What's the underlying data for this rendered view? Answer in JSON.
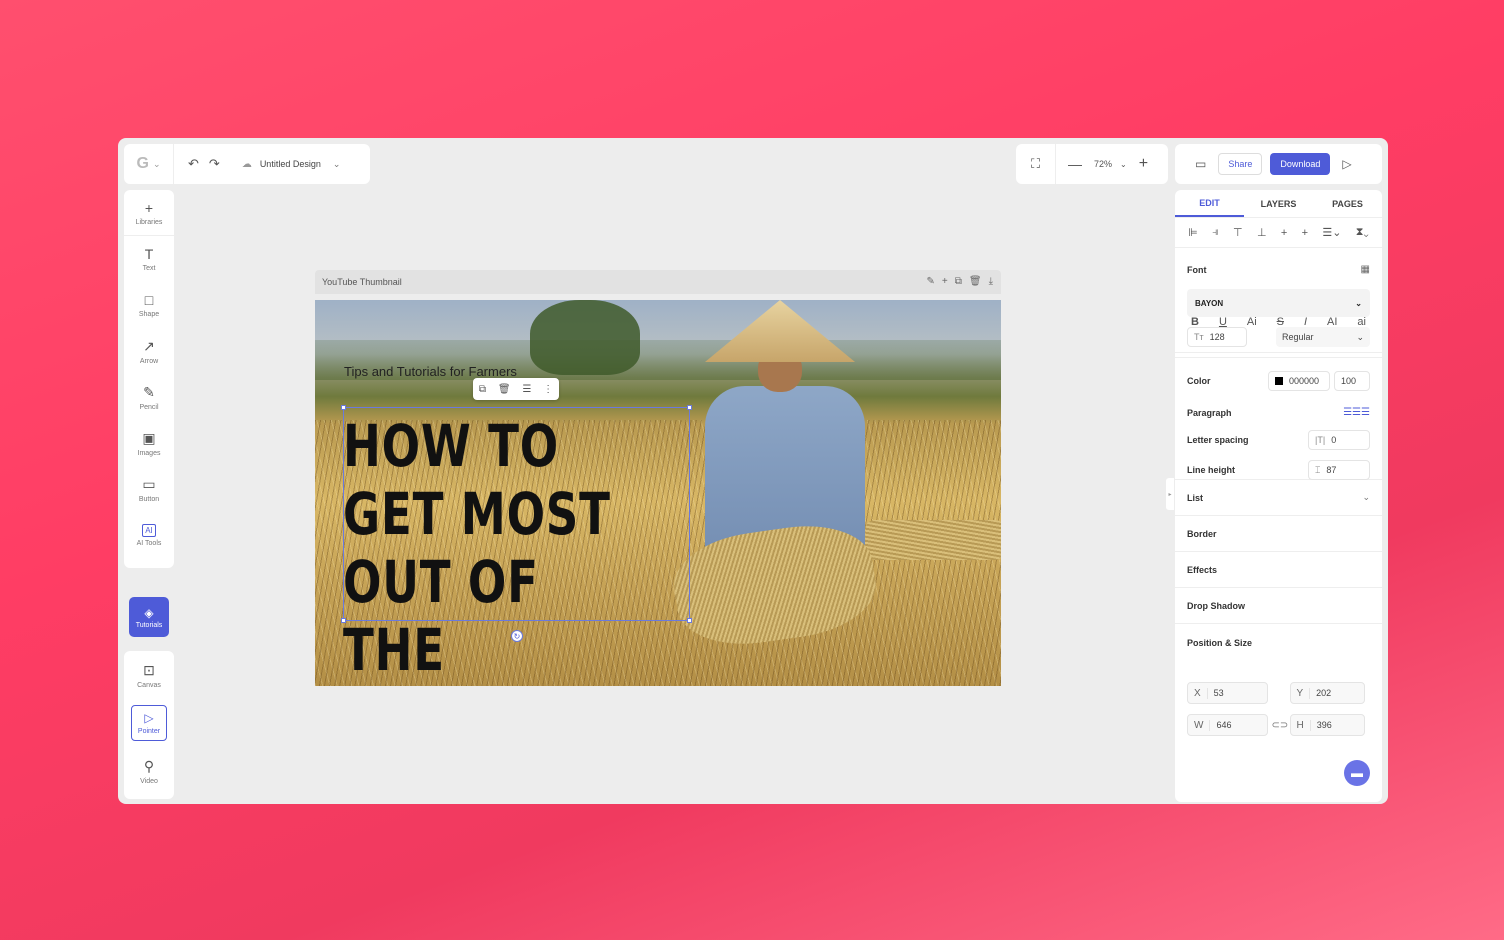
{
  "header": {
    "logo_char": "G",
    "design_title": "Untitled Design",
    "zoom": "72%",
    "share_label": "Share",
    "download_label": "Download"
  },
  "left_tools": [
    {
      "label": "Libraries",
      "icon": "+"
    },
    {
      "label": "Text",
      "icon": "T"
    },
    {
      "label": "Shape",
      "icon": "□"
    },
    {
      "label": "Arrow",
      "icon": "↗"
    },
    {
      "label": "Pencil",
      "icon": "✎"
    },
    {
      "label": "Images",
      "icon": "▣"
    },
    {
      "label": "Button",
      "icon": "▭"
    },
    {
      "label": "AI Tools",
      "icon": "AI"
    }
  ],
  "tutorials_label": "Tutorials",
  "bottom_tools": {
    "canvas": "Canvas",
    "pointer": "Pointer",
    "video": "Video"
  },
  "artboard": {
    "name": "YouTube Thumbnail",
    "subtitle": "Tips and Tutorials for Farmers",
    "headline": "HOW TO GET MOST OUT OF THE FIELDS"
  },
  "panel": {
    "tabs": [
      "EDIT",
      "LAYERS",
      "PAGES"
    ],
    "font_label": "Font",
    "font_name": "BAYON",
    "font_size": "128",
    "font_weight": "Regular",
    "style_buttons": [
      "B",
      "U",
      "Ai",
      "S",
      "I",
      "AI",
      "ai"
    ],
    "color_label": "Color",
    "color_hex": "000000",
    "opacity": "100",
    "paragraph_label": "Paragraph",
    "letter_spacing_label": "Letter spacing",
    "letter_spacing": "0",
    "line_height_label": "Line height",
    "line_height": "87",
    "list_label": "List",
    "border_label": "Border",
    "effects_label": "Effects",
    "drop_shadow_label": "Drop Shadow",
    "position_label": "Position & Size",
    "x": "53",
    "y": "202",
    "w": "646",
    "h": "396"
  },
  "colors": {
    "accent": "#4e5bd8",
    "background": "#ff4466"
  }
}
